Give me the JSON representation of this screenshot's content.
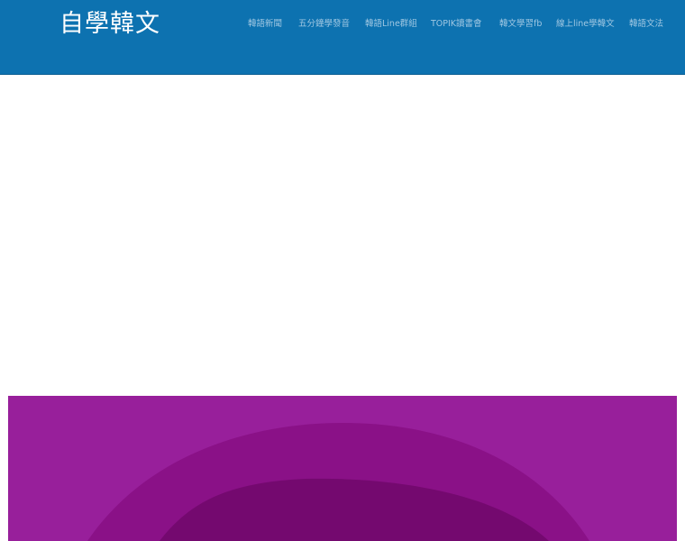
{
  "header": {
    "site_title": "自學韓文",
    "background_color": "#0d72b0"
  },
  "nav": {
    "items": [
      {
        "label": "韓語新聞"
      },
      {
        "label": "五分鐘學發音"
      },
      {
        "label": "韓語Line群組"
      },
      {
        "label": "TOPIK讀書會"
      },
      {
        "label": "韓文學習fb"
      },
      {
        "label": "線上line學韓文"
      },
      {
        "label": "韓語文法"
      }
    ]
  },
  "hero": {
    "colors": {
      "outer": "#981f9b",
      "middle": "#8a1187",
      "inner": "#74096f"
    }
  }
}
